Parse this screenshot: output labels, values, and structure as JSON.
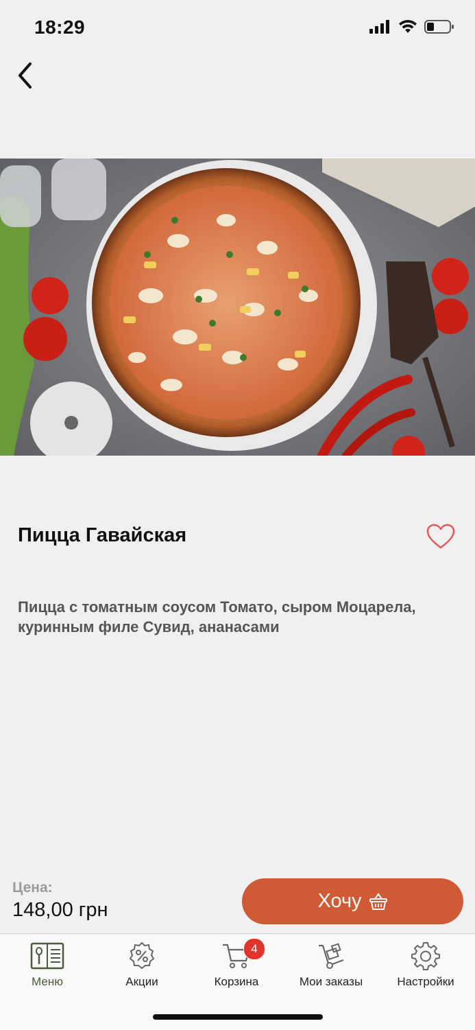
{
  "status_bar": {
    "time": "18:29"
  },
  "product": {
    "title": "Пицца Гавайская",
    "description": "Пицца с томатным соусом Томато, сыром Моцарела, куринным филе Сувид, ананасами",
    "image_alt": "Hawaiian pizza photo"
  },
  "price": {
    "label": "Цена:",
    "value": "148,00 грн"
  },
  "buy_button": {
    "label": "Хочу"
  },
  "tabs": [
    {
      "label": "Меню",
      "icon": "menu-book-icon",
      "active": true
    },
    {
      "label": "Акции",
      "icon": "percent-badge-icon",
      "active": false
    },
    {
      "label": "Корзина",
      "icon": "cart-icon",
      "badge": "4",
      "active": false
    },
    {
      "label": "Мои заказы",
      "icon": "hand-truck-icon",
      "active": false
    },
    {
      "label": "Настройки",
      "icon": "gear-icon",
      "active": false
    }
  ],
  "colors": {
    "accent": "#cf5a36",
    "active_tab": "#4a5a3e",
    "badge": "#e0352b",
    "heart": "#e05a5a"
  }
}
